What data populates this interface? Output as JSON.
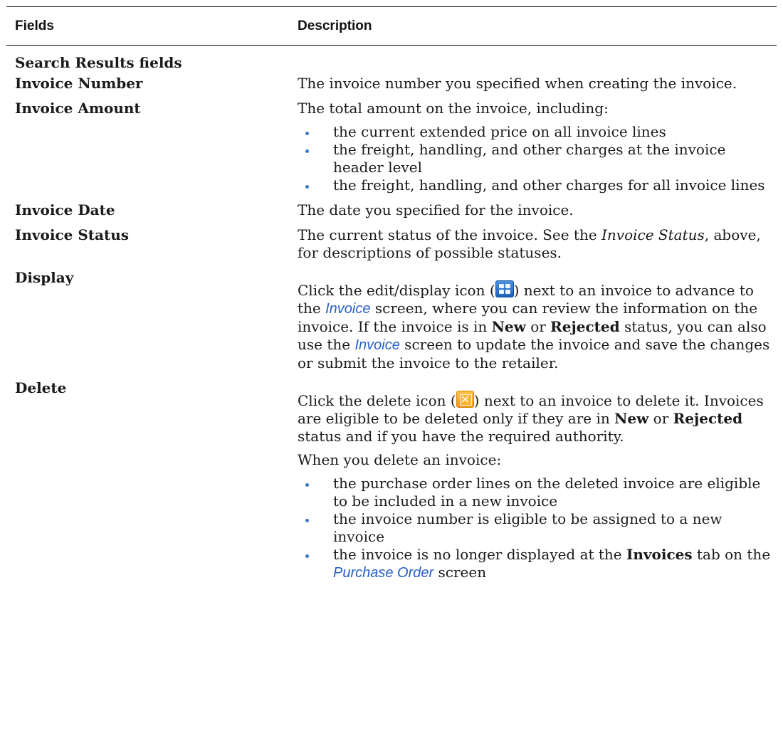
{
  "header": {
    "fields": "Fields",
    "description": "Description"
  },
  "section_label": "Search Results fields",
  "rows": {
    "invoice_number": {
      "field": "Invoice Number",
      "desc": "The invoice number you specified when creating the invoice."
    },
    "invoice_amount": {
      "field": "Invoice Amount",
      "desc": "The total amount on the invoice, including:",
      "bullets": [
        "the current extended price on all invoice lines",
        "the freight, handling, and other charges at the invoice header level",
        "the freight, handling, and other charges for all invoice lines"
      ]
    },
    "invoice_date": {
      "field": "Invoice Date",
      "desc": "The date you specified for the invoice."
    },
    "invoice_status": {
      "field": "Invoice Status",
      "desc_a": "The current status of the invoice. See the ",
      "desc_em": "Invoice Status",
      "desc_b": ", above, for descriptions of possible statuses."
    },
    "display": {
      "field": "Display",
      "t1": "Click the edit/display icon (",
      "t2": ") next to an invoice to advance to the ",
      "link1": "Invoice",
      "t3": " screen, where you can review the information on the invoice. If the invoice is in ",
      "b1": "New",
      "t4": " or ",
      "b2": "Rejected",
      "t5": " status, you can also use the ",
      "link2": "Invoice",
      "t6": " screen to update the invoice and save the changes or submit the invoice to the retailer."
    },
    "delete": {
      "field": "Delete",
      "t1": "Click the delete icon (",
      "t2": ") next to an invoice to delete it. Invoices are eligible to be deleted only if they are in ",
      "b1": "New",
      "t3": " or ",
      "b2": "Rejected",
      "t4": " status and if you have the required authority.",
      "p2": "When you delete an invoice:",
      "bullet1": "the purchase order lines on the deleted invoice are eligible to be included in a new invoice",
      "bullet2": "the invoice number is eligible to be assigned to a new invoice",
      "bullet3_a": "the invoice is no longer displayed at the ",
      "bullet3_b": "Invoices",
      "bullet3_c": " tab on the ",
      "bullet3_link": "Purchase Order",
      "bullet3_d": " screen"
    }
  },
  "icons": {
    "edit_display": "edit-display-icon",
    "delete": "delete-icon"
  },
  "colors": {
    "link": "#2660c8",
    "bullet": "#3a78c8",
    "edit_icon": "#2f7ad0",
    "delete_icon": "#f5a623"
  }
}
